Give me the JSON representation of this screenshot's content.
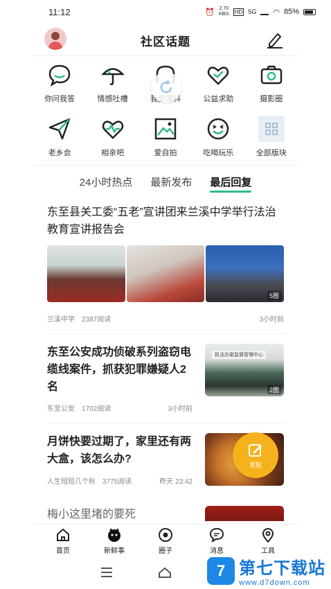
{
  "status_bar": {
    "time": "11:12",
    "net_speed": "2.70\nKB/s",
    "signal": "5G",
    "battery": "85%"
  },
  "header": {
    "title": "社区话题"
  },
  "categories": [
    {
      "label": "你问我答",
      "icon": "chat-bubble-icon"
    },
    {
      "label": "情感吐槽",
      "icon": "umbrella-icon"
    },
    {
      "label": "我要爆料",
      "icon": "announce-icon"
    },
    {
      "label": "公益求助",
      "icon": "heart-icon"
    },
    {
      "label": "摄影圈",
      "icon": "camera-icon"
    },
    {
      "label": "老乡会",
      "icon": "paper-plane-icon"
    },
    {
      "label": "相亲吧",
      "icon": "pulse-heart-icon"
    },
    {
      "label": "爱自拍",
      "icon": "picture-icon"
    },
    {
      "label": "吃喝玩乐",
      "icon": "smile-icon"
    },
    {
      "label": "全部版块",
      "icon": "grid-icon"
    }
  ],
  "tabs": [
    {
      "label": "24小时热点",
      "active": false
    },
    {
      "label": "最新发布",
      "active": false
    },
    {
      "label": "最后回复",
      "active": true
    }
  ],
  "articles": [
    {
      "title": "东至县关工委“五老”宣讲团来兰溪中学举行法治教育宣讲报告会",
      "source": "兰溪中学",
      "reads": "2387阅读",
      "time": "3小时前",
      "image_count": "5图"
    },
    {
      "title": "东至公安成功侦破系列盗窃电缆线案件，抓获犯罪嫌疑人2名",
      "source": "东至公安",
      "reads": "1702阅读",
      "time": "3小时前",
      "image_count": "2图",
      "thumb_sign": "执法办案监督管理中心"
    },
    {
      "title": "月饼快要过期了，家里还有两大盒，该怎么办?",
      "source": "人生短短几个秋",
      "reads": "3775阅读",
      "time": "昨天 23:42"
    },
    {
      "title": "梅小这里堵的要死"
    }
  ],
  "fab": {
    "label": "发贴"
  },
  "bottom_nav": [
    {
      "label": "首页",
      "icon": "home-icon"
    },
    {
      "label": "新鲜事",
      "icon": "mascot-icon"
    },
    {
      "label": "圈子",
      "icon": "circle-icon"
    },
    {
      "label": "消息",
      "icon": "message-icon"
    },
    {
      "label": "工具",
      "icon": "location-icon"
    }
  ],
  "watermark": {
    "logo": "7",
    "main": "第七下载站",
    "sub": "www.d7down.com"
  },
  "colors": {
    "accent": "#2fb98a",
    "fab": "#f5b21c",
    "watermark": "#1976d2"
  }
}
